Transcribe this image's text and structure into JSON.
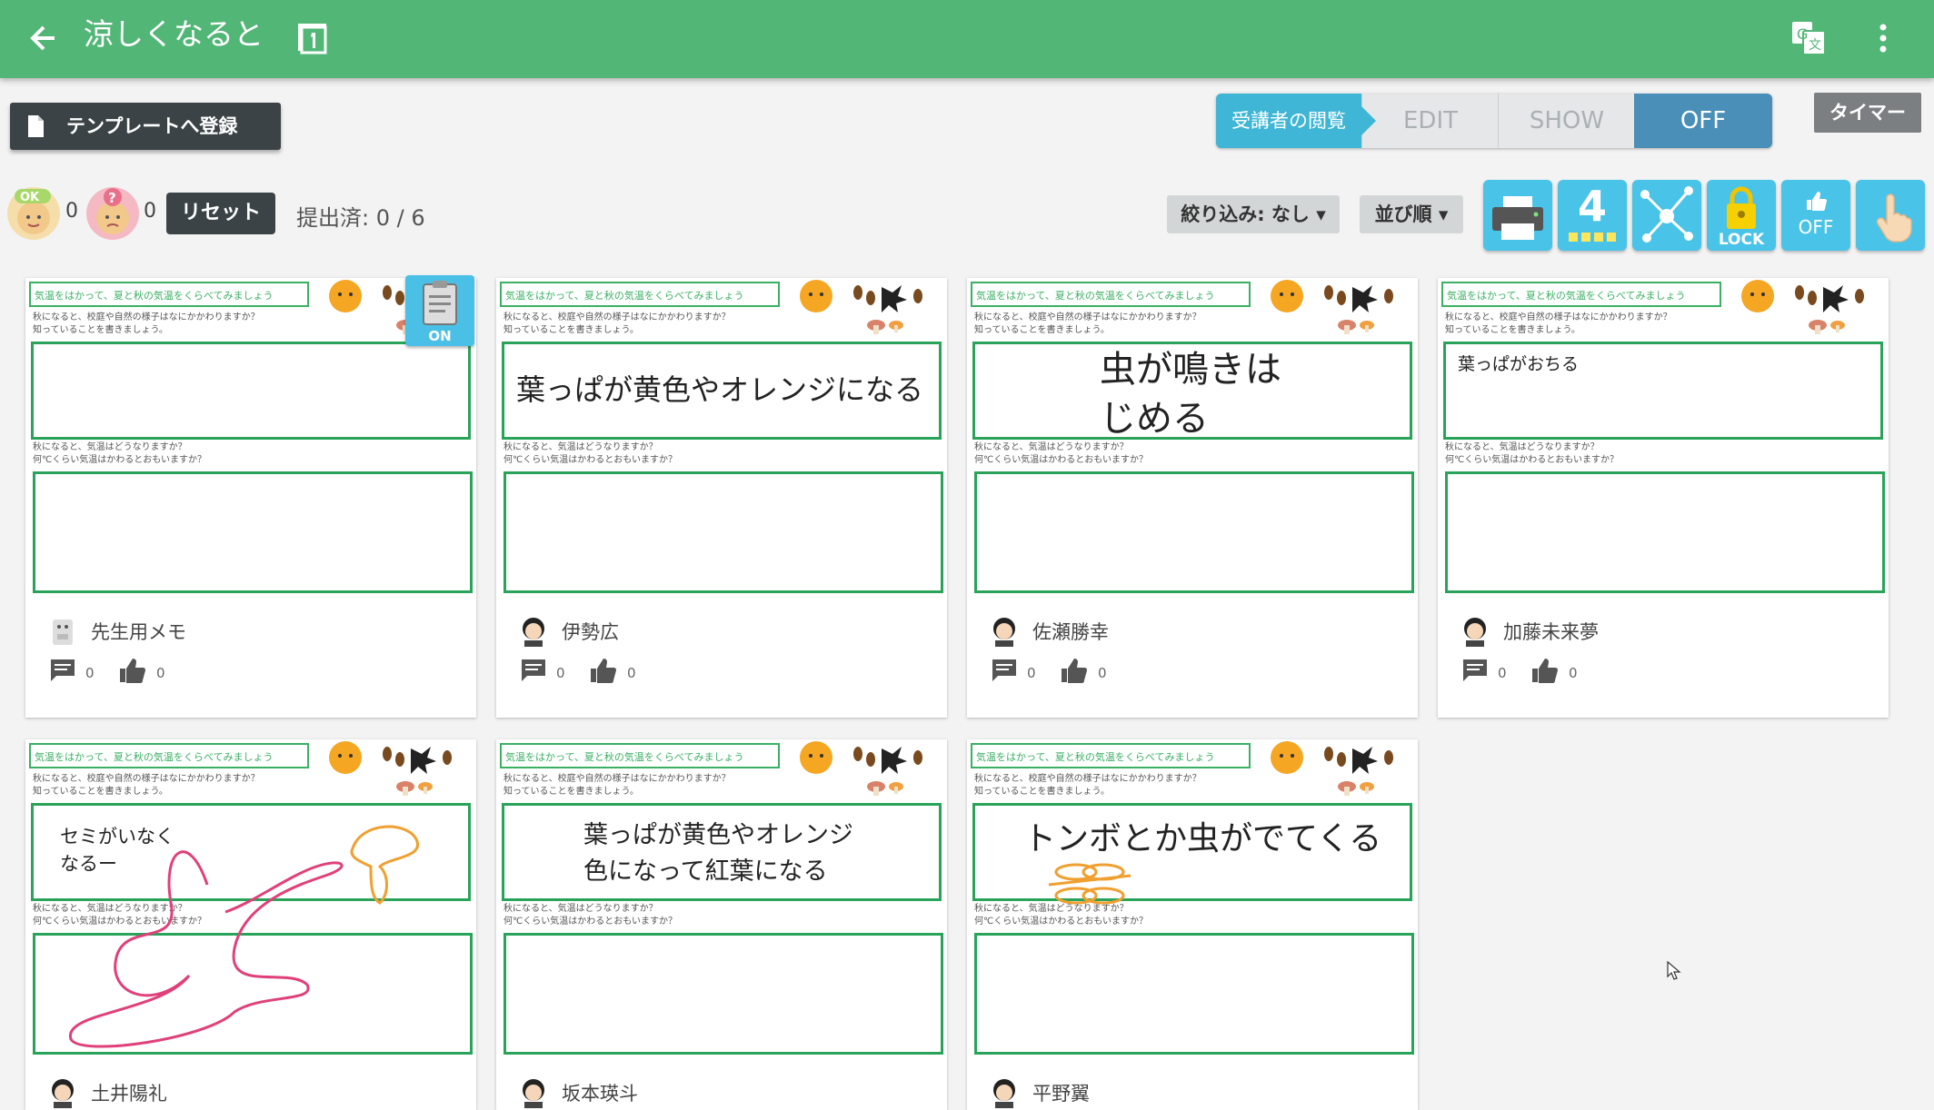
{
  "header": {
    "title": "涼しくなると",
    "colors": {
      "bar": "#52b676"
    }
  },
  "toolbar": {
    "template_label": "テンプレートへ登録",
    "timer_label": "タイマー"
  },
  "viewer": {
    "label": "受講者の閲覧",
    "edit": "EDIT",
    "show": "SHOW",
    "off": "OFF"
  },
  "status": {
    "ok_badge": "OK",
    "ok_count": "0",
    "question_count": "0",
    "reset_label": "リセット",
    "submitted": "提出済: 0 / 6"
  },
  "filters": {
    "filter_label": "絞り込み: なし",
    "sort_label": "並び順"
  },
  "tools": {
    "columns": "4",
    "lock_label": "LOCK",
    "like_label": "OFF"
  },
  "memo_badge": "ON",
  "worksheet": {
    "header": "気温をはかって、夏と秋の気温をくらべてみましょう",
    "q1_line1": "秋になると、校庭や自然の様子はなにかかわりますか？",
    "q1_line2": "知っていることを書きましょう。",
    "q2_line1": "秋になると、気温はどうなりますか？",
    "q2_line2": "何℃くらい気温はかわるとおもいますか？"
  },
  "cards": [
    {
      "name": "先生用メモ",
      "answer": "",
      "comments": "0",
      "likes": "0"
    },
    {
      "name": "伊勢広",
      "answer": "葉っぱが黄色やオレンジになる",
      "comments": "0",
      "likes": "0"
    },
    {
      "name": "佐瀬勝幸",
      "answer": "虫が鳴きは\nじめる",
      "comments": "0",
      "likes": "0"
    },
    {
      "name": "加藤未来夢",
      "answer": "葉っぱがおちる",
      "comments": "0",
      "likes": "0"
    },
    {
      "name": "土井陽礼",
      "answer": "セミがいなく\nなるー",
      "comments": "0",
      "likes": "0"
    },
    {
      "name": "坂本瑛斗",
      "answer": "葉っぱが黄色やオレンジ\n色になって紅葉になる",
      "comments": "0",
      "likes": "0"
    },
    {
      "name": "平野翼",
      "answer": "トンボとか虫がでてくる",
      "comments": "0",
      "likes": "0"
    }
  ]
}
